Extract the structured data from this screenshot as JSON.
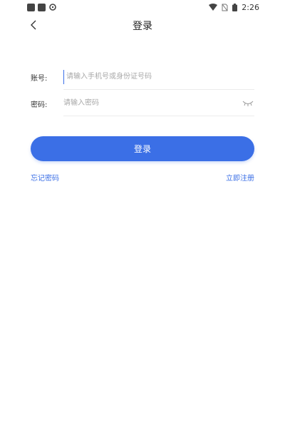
{
  "status_bar": {
    "time": "2:26",
    "icons": [
      "app-notification-icon",
      "app-notification-icon",
      "sync-icon",
      "wifi-icon",
      "no-sim-icon",
      "battery-icon"
    ]
  },
  "header": {
    "title": "登录",
    "back_icon": "chevron-left-icon"
  },
  "form": {
    "account": {
      "label": "账号:",
      "value": "",
      "placeholder": "请输入手机号或身份证号码"
    },
    "password": {
      "label": "密码:",
      "value": "",
      "placeholder": "请输入密码",
      "toggle_icon": "eye-closed-icon"
    }
  },
  "actions": {
    "login_label": "登录",
    "forgot_password": "忘记密码",
    "register": "立即注册"
  },
  "colors": {
    "accent": "#3b6fe6",
    "background": "#ffffff",
    "placeholder": "#a8a8a8"
  }
}
